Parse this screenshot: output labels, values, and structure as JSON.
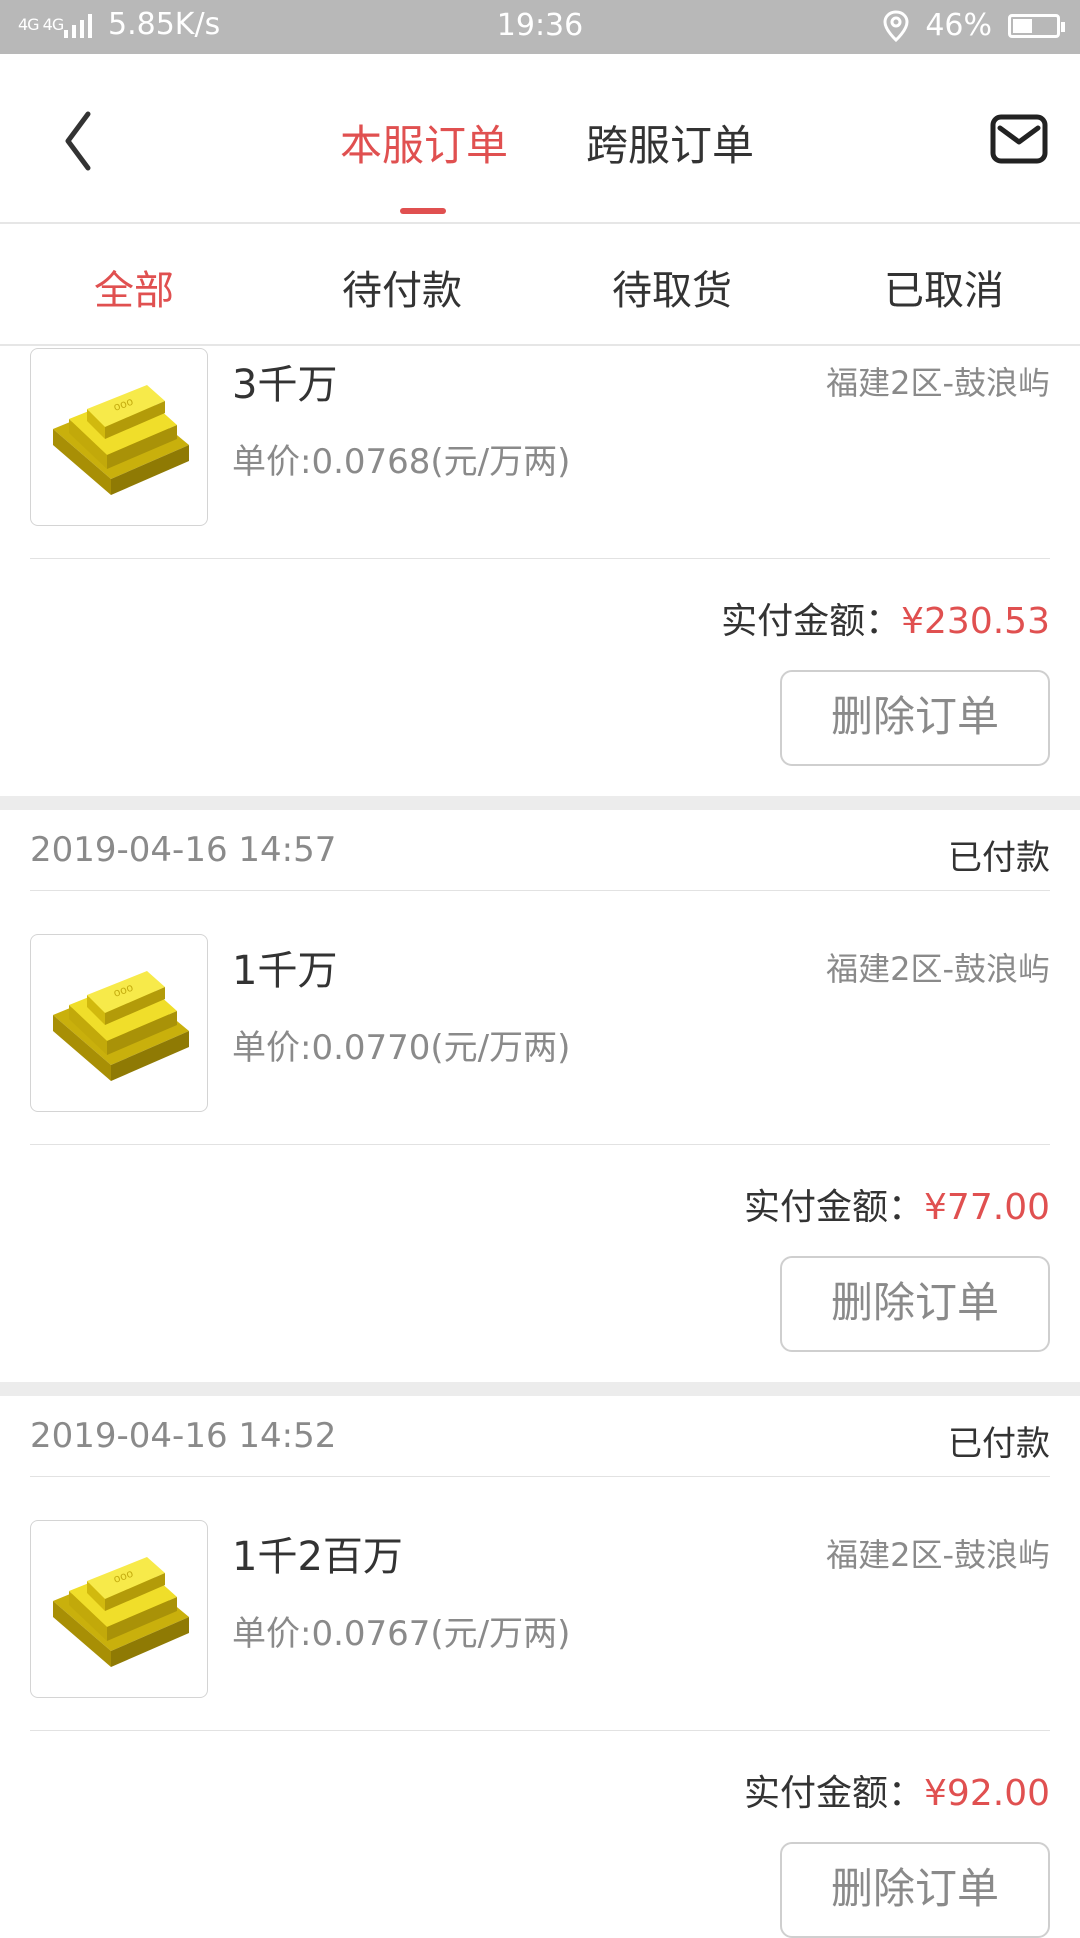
{
  "status_bar": {
    "network_type": "4G 4G",
    "speed": "5.85K/s",
    "time": "19:36",
    "battery": "46%",
    "battery_level": 0.46
  },
  "nav": {
    "tab_local": "本服订单",
    "tab_cross": "跨服订单",
    "active_tab": "本服订单"
  },
  "filters": {
    "all": "全部",
    "pending_payment": "待付款",
    "pending_pickup": "待取货",
    "cancelled": "已取消",
    "active": "全部"
  },
  "labels": {
    "paid_prefix": "实付金额：",
    "delete": "删除订单"
  },
  "orders": [
    {
      "title": "3千万",
      "server": "福建2区-鼓浪屿",
      "price": "单价:0.0768(元/万两)",
      "amount": "¥230.53"
    },
    {
      "date": "2019-04-16 14:57",
      "status": "已付款",
      "title": "1千万",
      "server": "福建2区-鼓浪屿",
      "price": "单价:0.0770(元/万两)",
      "amount": "¥77.00"
    },
    {
      "date": "2019-04-16 14:52",
      "status": "已付款",
      "title": "1千2百万",
      "server": "福建2区-鼓浪屿",
      "price": "单价:0.0767(元/万两)",
      "amount": "¥92.00"
    }
  ],
  "colors": {
    "accent": "#e05050",
    "status_bar": "#b8b8b8",
    "gold": "#e8d21a"
  },
  "icons": [
    "back-icon",
    "mail-icon",
    "gold-bars-icon",
    "location-icon",
    "battery-icon",
    "signal-icon"
  ]
}
